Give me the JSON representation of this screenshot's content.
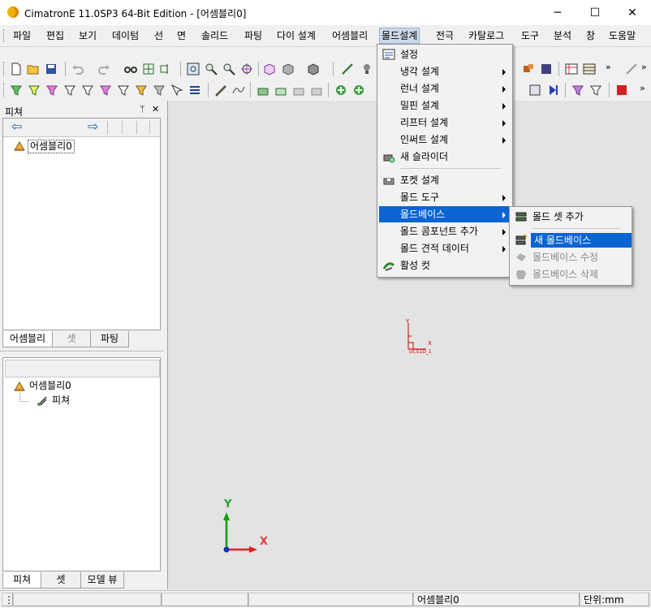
{
  "window": {
    "title": "CimatronE 11.0SP3 64-Bit Edition - [어셈블리0]",
    "minimize_glyph": "─",
    "maximize_glyph": "☐",
    "close_glyph": "✕"
  },
  "menubar": {
    "items": [
      "파일",
      "편집",
      "보기",
      "데이텀",
      "선",
      "면",
      "솔리드",
      "파팅",
      "다이 설계",
      "어셈블리",
      "몰드설계",
      "전극",
      "카탈로그",
      "도구",
      "분석",
      "창",
      "도움말"
    ],
    "active": "몰드설계"
  },
  "panel_top": {
    "title": "피쳐",
    "pin_glyph": "ᛘ",
    "close_glyph": "✕",
    "back_arrow": "⇦",
    "forward_arrow": "⇨",
    "tree_root": "어셈블리0",
    "tabs": [
      "어셈블리",
      "셋",
      "파팅"
    ]
  },
  "panel_bottom": {
    "tree_root": "어셈블리0",
    "tree_child": "피쳐",
    "tabs": [
      "피쳐",
      "셋",
      "모델 뷰"
    ]
  },
  "mold_menu": {
    "items": [
      {
        "label": "설정",
        "icon": "settings-icon",
        "submenu": false
      },
      {
        "label": "냉각 설계",
        "icon": "",
        "submenu": true
      },
      {
        "label": "런너 설계",
        "icon": "",
        "submenu": true
      },
      {
        "label": "밀핀 설계",
        "icon": "",
        "submenu": true
      },
      {
        "label": "리프터 설계",
        "icon": "",
        "submenu": true
      },
      {
        "label": "인써트 설계",
        "icon": "",
        "submenu": true
      },
      {
        "label": "새 슬라이더",
        "icon": "slider-icon",
        "submenu": false
      },
      {
        "label": "포켓 설계",
        "icon": "pocket-icon",
        "submenu": false
      },
      {
        "label": "몰드 도구",
        "icon": "",
        "submenu": true
      },
      {
        "label": "몰드베이스",
        "icon": "",
        "submenu": true,
        "highlighted": true
      },
      {
        "label": "몰드 콤포넌트 추가",
        "icon": "",
        "submenu": true
      },
      {
        "label": "몰드 견적 데이터",
        "icon": "",
        "submenu": true
      },
      {
        "label": "활성 컷",
        "icon": "active-cut-icon",
        "submenu": false
      }
    ]
  },
  "moldbase_submenu": {
    "items": [
      {
        "label": "몰드 셋 추가",
        "icon": "add-mold-set-icon",
        "enabled": true
      },
      {
        "label": "새 몰드베이스",
        "icon": "new-moldbase-icon",
        "enabled": true,
        "highlighted": true
      },
      {
        "label": "몰드베이스 수정",
        "icon": "edit-moldbase-icon",
        "enabled": false
      },
      {
        "label": "몰드베이스 삭제",
        "icon": "delete-moldbase-icon",
        "enabled": false
      }
    ]
  },
  "viewport": {
    "ucs_label": "UCS1D_1",
    "ucs_x": "X",
    "ucs_y": "Y",
    "axis_x": "X",
    "axis_y": "Y"
  },
  "statusbar": {
    "glyph": "⋮",
    "assembly": "어셈블리0",
    "units": "단위:mm"
  },
  "colors": {
    "accent_highlight": "#0a64d2",
    "axis_x": "#ff2020",
    "axis_y": "#00b000",
    "ucs_red": "#d00000"
  }
}
